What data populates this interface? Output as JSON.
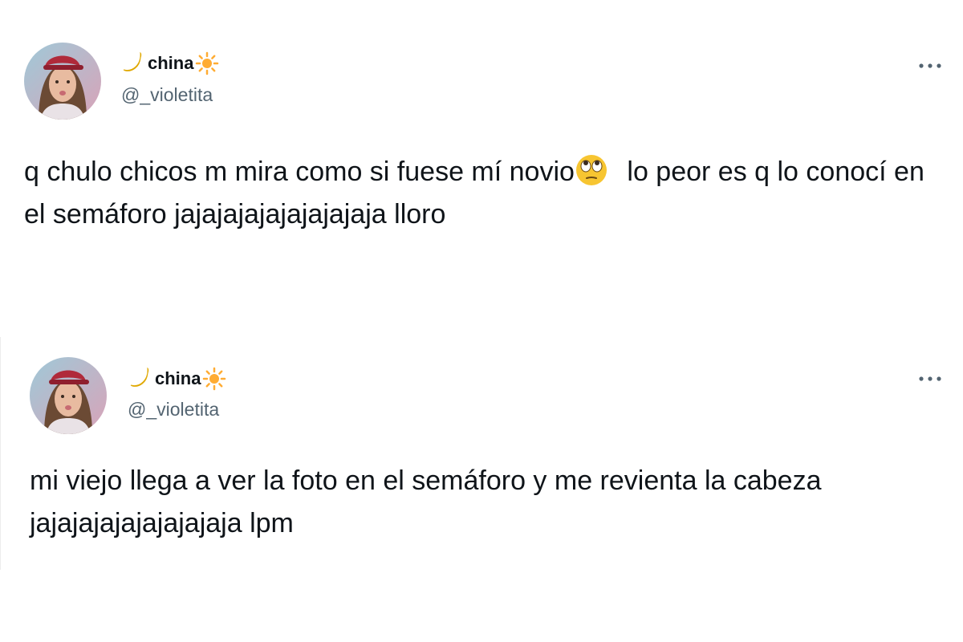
{
  "tweets": [
    {
      "user": {
        "display_name": "china",
        "handle": "@_violetita",
        "name_prefix_icon": "crescent-moon-icon",
        "name_suffix_icon": "sun-icon"
      },
      "more_icon": "more-options-icon",
      "text": {
        "part1": "q chulo chicos m mira como si fuese mí novio",
        "emoji": "face-with-rolling-eyes-icon",
        "part2": "lo peor es q lo conocí en el semáforo jajajajajajajajajaja lloro"
      }
    },
    {
      "user": {
        "display_name": "china",
        "handle": "@_violetita",
        "name_prefix_icon": "crescent-moon-icon",
        "name_suffix_icon": "sun-icon"
      },
      "more_icon": "more-options-icon",
      "text": {
        "full": "mi viejo llega a ver la foto en el semáforo y me revienta la cabeza jajajajajajajajajaja lpm"
      }
    }
  ],
  "colors": {
    "text": "#0f1419",
    "handle": "#536471",
    "emoji_yellow": "#f7c531",
    "moon_yellow": "#ffcc4d"
  }
}
